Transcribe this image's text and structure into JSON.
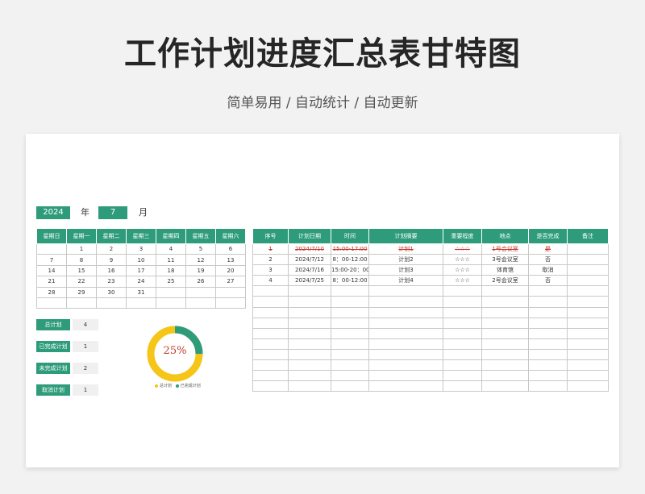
{
  "header": {
    "title": "工作计划进度汇总表甘特图",
    "subtitle": "简单易用 / 自动统计 / 自动更新"
  },
  "selector": {
    "year": "2024",
    "year_label": "年",
    "month": "7",
    "month_label": "月"
  },
  "calendar": {
    "headers": [
      "星期日",
      "星期一",
      "星期二",
      "星期三",
      "星期四",
      "星期五",
      "星期六"
    ],
    "rows": [
      [
        "",
        "1",
        "2",
        "3",
        "4",
        "5",
        "6"
      ],
      [
        "7",
        "8",
        "9",
        "10",
        "11",
        "12",
        "13"
      ],
      [
        "14",
        "15",
        "16",
        "17",
        "18",
        "19",
        "20"
      ],
      [
        "21",
        "22",
        "23",
        "24",
        "25",
        "26",
        "27"
      ],
      [
        "28",
        "29",
        "30",
        "31",
        "",
        "",
        ""
      ],
      [
        "",
        "",
        "",
        "",
        "",
        "",
        ""
      ]
    ]
  },
  "stats": [
    {
      "label": "总计划",
      "value": "4"
    },
    {
      "label": "已完成计划",
      "value": "1"
    },
    {
      "label": "未完成计划",
      "value": "2"
    },
    {
      "label": "取消计划",
      "value": "1"
    }
  ],
  "progress": {
    "percent_label": "25%",
    "fraction": 0.25,
    "legend": [
      "总计划",
      "已完成计划"
    ]
  },
  "colors": {
    "accent": "#2e9c7a",
    "donut_total": "#f5c518",
    "donut_done": "#2e9c7a",
    "cancel_text": "#c0392b"
  },
  "plan": {
    "headers": [
      "序号",
      "计划日期",
      "时间",
      "计划摘要",
      "重要程度",
      "地点",
      "是否完成",
      "备注"
    ],
    "rows": [
      {
        "no": "1",
        "date": "2024/7/10",
        "time": "15:00-17:00",
        "summary": "计划1",
        "importance": "☆☆☆",
        "place": "1号会议室",
        "done": "是",
        "note": ""
      },
      {
        "no": "2",
        "date": "2024/7/12",
        "time": "8：00-12:00",
        "summary": "计划2",
        "importance": "☆☆☆",
        "place": "3号会议室",
        "done": "否",
        "note": ""
      },
      {
        "no": "3",
        "date": "2024/7/16",
        "time": "15:00-20：00",
        "summary": "计划3",
        "importance": "☆☆☆",
        "place": "体育馆",
        "done": "取消",
        "note": ""
      },
      {
        "no": "4",
        "date": "2024/7/25",
        "time": "8：00-12:00",
        "summary": "计划4",
        "importance": "☆☆☆",
        "place": "2号会议室",
        "done": "否",
        "note": ""
      }
    ],
    "empty_rows": 10
  }
}
